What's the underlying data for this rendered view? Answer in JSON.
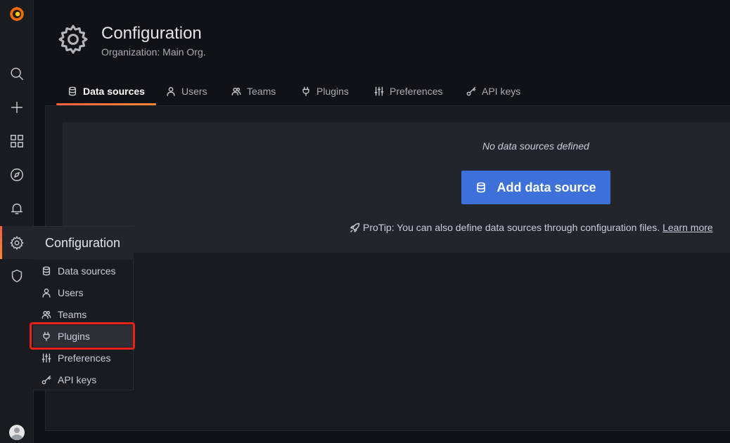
{
  "header": {
    "title": "Configuration",
    "subtitle": "Organization: Main Org."
  },
  "tabs": [
    {
      "label": "Data sources",
      "icon": "database-icon",
      "active": true
    },
    {
      "label": "Users",
      "icon": "user-icon"
    },
    {
      "label": "Teams",
      "icon": "users-icon"
    },
    {
      "label": "Plugins",
      "icon": "plug-icon"
    },
    {
      "label": "Preferences",
      "icon": "sliders-icon"
    },
    {
      "label": "API keys",
      "icon": "key-icon"
    }
  ],
  "empty_state": {
    "message": "No data sources defined",
    "button_label": "Add data source",
    "protip": "ProTip: You can also define data sources through configuration files.",
    "protip_link": "Learn more"
  },
  "flyout": {
    "title": "Configuration",
    "items": [
      {
        "label": "Data sources",
        "icon": "database-icon"
      },
      {
        "label": "Users",
        "icon": "user-icon"
      },
      {
        "label": "Teams",
        "icon": "users-icon"
      },
      {
        "label": "Plugins",
        "icon": "plug-icon",
        "highlighted": true
      },
      {
        "label": "Preferences",
        "icon": "sliders-icon"
      },
      {
        "label": "API keys",
        "icon": "key-icon"
      }
    ]
  },
  "colors": {
    "accent": "#3d71d9",
    "active_gradient_start": "#f55f3e",
    "active_gradient_end": "#ff8833",
    "highlight_box": "#e8211a"
  }
}
